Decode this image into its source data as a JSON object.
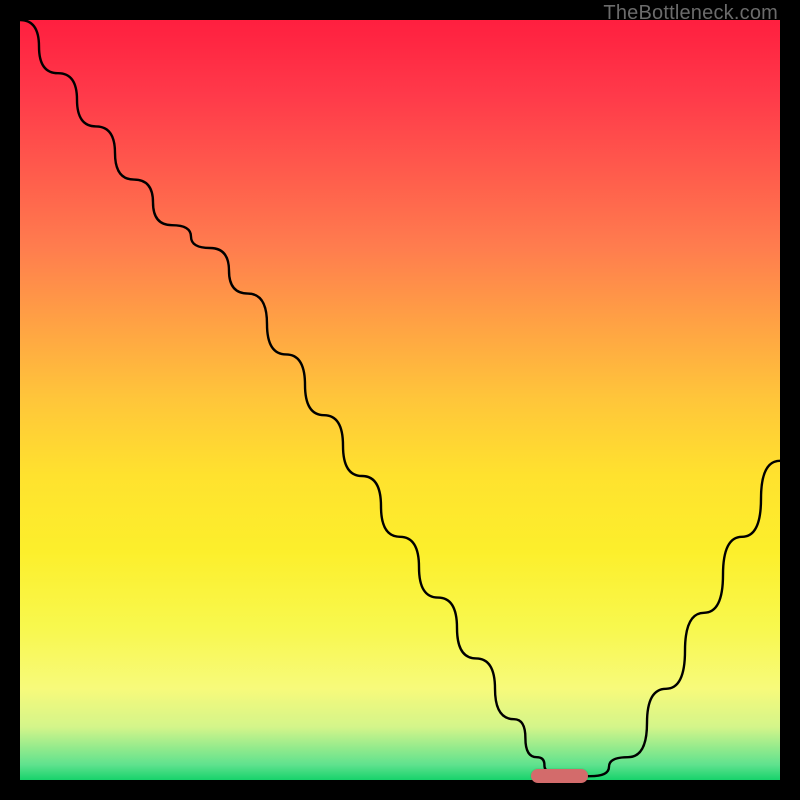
{
  "watermark": "TheBottleneck.com",
  "chart_data": {
    "type": "line",
    "title": "",
    "xlabel": "",
    "ylabel": "",
    "xlim": [
      0,
      100
    ],
    "ylim": [
      0,
      100
    ],
    "x": [
      0,
      5,
      10,
      15,
      20,
      25,
      30,
      35,
      40,
      45,
      50,
      55,
      60,
      65,
      68,
      70,
      72,
      75,
      80,
      85,
      90,
      95,
      100
    ],
    "values": [
      100,
      93,
      86,
      79,
      73,
      70,
      64,
      56,
      48,
      40,
      32,
      24,
      16,
      8,
      3,
      1,
      0.5,
      0.5,
      3,
      12,
      22,
      32,
      42
    ],
    "marker": {
      "x_center": 71,
      "y": 0.5,
      "width_frac": 0.076
    },
    "background_gradient": {
      "top": "#ff1f3f",
      "bottom": "#17d36b"
    }
  },
  "colors": {
    "curve": "#000000",
    "marker": "#d36b6b",
    "frame": "#000000"
  }
}
